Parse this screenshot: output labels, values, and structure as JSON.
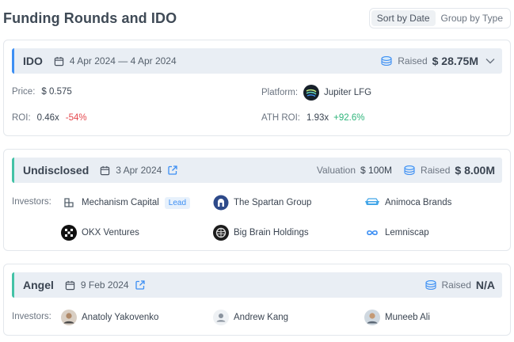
{
  "header": {
    "title": "Funding Rounds and IDO",
    "sort_options": [
      "Sort by Date",
      "Group by Type"
    ]
  },
  "rounds": [
    {
      "type": "IDO",
      "date": "4 Apr 2024 — 4 Apr 2024",
      "raised_label": "Raised",
      "raised_value": "$ 28.75M",
      "price_label": "Price:",
      "price_value": "$ 0.575",
      "platform_label": "Platform:",
      "platform_value": "Jupiter LFG",
      "roi_label": "ROI:",
      "roi_value": "0.46x",
      "roi_change": "-54%",
      "ath_roi_label": "ATH ROI:",
      "ath_roi_value": "1.93x",
      "ath_roi_change": "+92.6%"
    },
    {
      "type": "Undisclosed",
      "date": "3 Apr 2024",
      "valuation_label": "Valuation",
      "valuation_value": "$ 100M",
      "raised_label": "Raised",
      "raised_value": "$ 8.00M",
      "investors_label": "Investors:",
      "investors": [
        {
          "name": "Mechanism Capital",
          "badge": "Lead",
          "icon": "mechanism-capital-logo"
        },
        {
          "name": "The Spartan Group",
          "icon": "spartan-group-logo"
        },
        {
          "name": "Animoca Brands",
          "icon": "animoca-brands-logo"
        },
        {
          "name": "OKX Ventures",
          "icon": "okx-ventures-logo"
        },
        {
          "name": "Big Brain Holdings",
          "icon": "big-brain-holdings-logo"
        },
        {
          "name": "Lemniscap",
          "icon": "lemniscap-logo"
        }
      ]
    },
    {
      "type": "Angel",
      "date": "9 Feb 2024",
      "raised_label": "Raised",
      "raised_value": "N/A",
      "investors_label": "Investors:",
      "investors": [
        {
          "name": "Anatoly Yakovenko",
          "icon": "person-avatar"
        },
        {
          "name": "Andrew Kang",
          "icon": "default-user-avatar"
        },
        {
          "name": "Muneeb Ali",
          "icon": "person-avatar"
        }
      ]
    }
  ],
  "colors": {
    "accent_blue": "#3d8ff3",
    "accent_teal": "#43c2a6",
    "negative": "#e5484d",
    "positive": "#2fb57b"
  }
}
